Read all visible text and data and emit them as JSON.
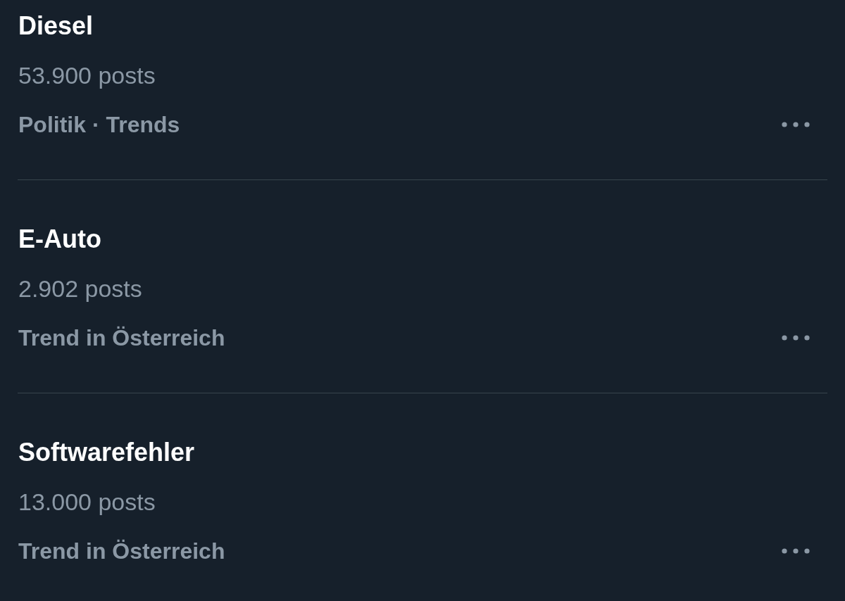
{
  "trends": [
    {
      "title": "Diesel",
      "posts": "53.900 posts",
      "category": "Politik · Trends"
    },
    {
      "title": "E-Auto",
      "posts": "2.902 posts",
      "category": "Trend in Österreich"
    },
    {
      "title": "Softwarefehler",
      "posts": "13.000 posts",
      "category": "Trend in Österreich"
    }
  ]
}
